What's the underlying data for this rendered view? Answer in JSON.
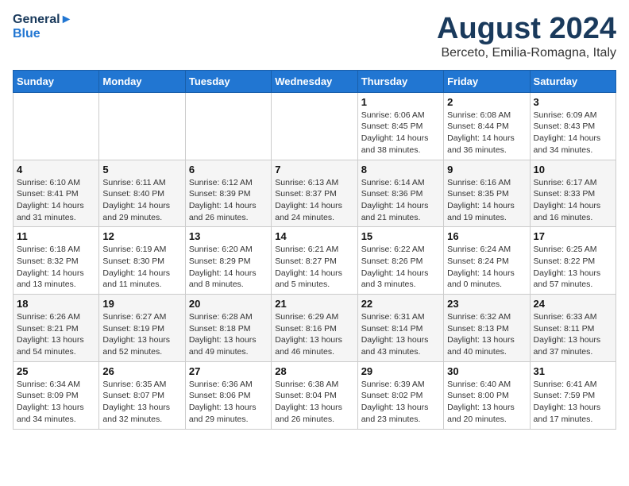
{
  "logo": {
    "line1": "General",
    "line2": "Blue"
  },
  "title": "August 2024",
  "subtitle": "Berceto, Emilia-Romagna, Italy",
  "days_of_week": [
    "Sunday",
    "Monday",
    "Tuesday",
    "Wednesday",
    "Thursday",
    "Friday",
    "Saturday"
  ],
  "weeks": [
    [
      {
        "day": "",
        "detail": ""
      },
      {
        "day": "",
        "detail": ""
      },
      {
        "day": "",
        "detail": ""
      },
      {
        "day": "",
        "detail": ""
      },
      {
        "day": "1",
        "detail": "Sunrise: 6:06 AM\nSunset: 8:45 PM\nDaylight: 14 hours\nand 38 minutes."
      },
      {
        "day": "2",
        "detail": "Sunrise: 6:08 AM\nSunset: 8:44 PM\nDaylight: 14 hours\nand 36 minutes."
      },
      {
        "day": "3",
        "detail": "Sunrise: 6:09 AM\nSunset: 8:43 PM\nDaylight: 14 hours\nand 34 minutes."
      }
    ],
    [
      {
        "day": "4",
        "detail": "Sunrise: 6:10 AM\nSunset: 8:41 PM\nDaylight: 14 hours\nand 31 minutes."
      },
      {
        "day": "5",
        "detail": "Sunrise: 6:11 AM\nSunset: 8:40 PM\nDaylight: 14 hours\nand 29 minutes."
      },
      {
        "day": "6",
        "detail": "Sunrise: 6:12 AM\nSunset: 8:39 PM\nDaylight: 14 hours\nand 26 minutes."
      },
      {
        "day": "7",
        "detail": "Sunrise: 6:13 AM\nSunset: 8:37 PM\nDaylight: 14 hours\nand 24 minutes."
      },
      {
        "day": "8",
        "detail": "Sunrise: 6:14 AM\nSunset: 8:36 PM\nDaylight: 14 hours\nand 21 minutes."
      },
      {
        "day": "9",
        "detail": "Sunrise: 6:16 AM\nSunset: 8:35 PM\nDaylight: 14 hours\nand 19 minutes."
      },
      {
        "day": "10",
        "detail": "Sunrise: 6:17 AM\nSunset: 8:33 PM\nDaylight: 14 hours\nand 16 minutes."
      }
    ],
    [
      {
        "day": "11",
        "detail": "Sunrise: 6:18 AM\nSunset: 8:32 PM\nDaylight: 14 hours\nand 13 minutes."
      },
      {
        "day": "12",
        "detail": "Sunrise: 6:19 AM\nSunset: 8:30 PM\nDaylight: 14 hours\nand 11 minutes."
      },
      {
        "day": "13",
        "detail": "Sunrise: 6:20 AM\nSunset: 8:29 PM\nDaylight: 14 hours\nand 8 minutes."
      },
      {
        "day": "14",
        "detail": "Sunrise: 6:21 AM\nSunset: 8:27 PM\nDaylight: 14 hours\nand 5 minutes."
      },
      {
        "day": "15",
        "detail": "Sunrise: 6:22 AM\nSunset: 8:26 PM\nDaylight: 14 hours\nand 3 minutes."
      },
      {
        "day": "16",
        "detail": "Sunrise: 6:24 AM\nSunset: 8:24 PM\nDaylight: 14 hours\nand 0 minutes."
      },
      {
        "day": "17",
        "detail": "Sunrise: 6:25 AM\nSunset: 8:22 PM\nDaylight: 13 hours\nand 57 minutes."
      }
    ],
    [
      {
        "day": "18",
        "detail": "Sunrise: 6:26 AM\nSunset: 8:21 PM\nDaylight: 13 hours\nand 54 minutes."
      },
      {
        "day": "19",
        "detail": "Sunrise: 6:27 AM\nSunset: 8:19 PM\nDaylight: 13 hours\nand 52 minutes."
      },
      {
        "day": "20",
        "detail": "Sunrise: 6:28 AM\nSunset: 8:18 PM\nDaylight: 13 hours\nand 49 minutes."
      },
      {
        "day": "21",
        "detail": "Sunrise: 6:29 AM\nSunset: 8:16 PM\nDaylight: 13 hours\nand 46 minutes."
      },
      {
        "day": "22",
        "detail": "Sunrise: 6:31 AM\nSunset: 8:14 PM\nDaylight: 13 hours\nand 43 minutes."
      },
      {
        "day": "23",
        "detail": "Sunrise: 6:32 AM\nSunset: 8:13 PM\nDaylight: 13 hours\nand 40 minutes."
      },
      {
        "day": "24",
        "detail": "Sunrise: 6:33 AM\nSunset: 8:11 PM\nDaylight: 13 hours\nand 37 minutes."
      }
    ],
    [
      {
        "day": "25",
        "detail": "Sunrise: 6:34 AM\nSunset: 8:09 PM\nDaylight: 13 hours\nand 34 minutes."
      },
      {
        "day": "26",
        "detail": "Sunrise: 6:35 AM\nSunset: 8:07 PM\nDaylight: 13 hours\nand 32 minutes."
      },
      {
        "day": "27",
        "detail": "Sunrise: 6:36 AM\nSunset: 8:06 PM\nDaylight: 13 hours\nand 29 minutes."
      },
      {
        "day": "28",
        "detail": "Sunrise: 6:38 AM\nSunset: 8:04 PM\nDaylight: 13 hours\nand 26 minutes."
      },
      {
        "day": "29",
        "detail": "Sunrise: 6:39 AM\nSunset: 8:02 PM\nDaylight: 13 hours\nand 23 minutes."
      },
      {
        "day": "30",
        "detail": "Sunrise: 6:40 AM\nSunset: 8:00 PM\nDaylight: 13 hours\nand 20 minutes."
      },
      {
        "day": "31",
        "detail": "Sunrise: 6:41 AM\nSunset: 7:59 PM\nDaylight: 13 hours\nand 17 minutes."
      }
    ]
  ]
}
